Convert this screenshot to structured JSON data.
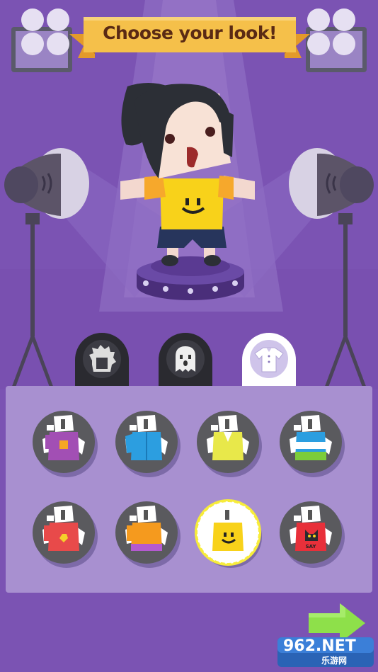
{
  "header": {
    "title": "Choose your look!"
  },
  "tabs": [
    {
      "name": "hair",
      "icon": "hair-icon",
      "selected": false
    },
    {
      "name": "face",
      "icon": "ghost-face-icon",
      "selected": false
    },
    {
      "name": "shirt",
      "icon": "shirt-icon",
      "selected": true
    }
  ],
  "outfits": [
    {
      "icon": "purple-shirt-icon",
      "color": "#a24fb4",
      "selected": false
    },
    {
      "icon": "blue-jacket-icon",
      "color": "#2c9ee0",
      "selected": false
    },
    {
      "icon": "yellow-vest-icon",
      "color": "#e8e84a",
      "selected": false
    },
    {
      "icon": "blue-striped-shirt-icon",
      "color": "#2c9ee0",
      "selected": false
    },
    {
      "icon": "red-flower-shirt-icon",
      "color": "#e84a4a",
      "selected": false
    },
    {
      "icon": "orange-shirt-icon",
      "color": "#f59a1e",
      "selected": false
    },
    {
      "icon": "yellow-smiley-shirt-icon",
      "color": "#f8d21a",
      "selected": true
    },
    {
      "icon": "red-cat-shirt-icon",
      "color": "#e8303a",
      "selected": false
    }
  ],
  "cat_shirt_text": "SAY",
  "watermark": {
    "brand": "962.NET",
    "subtitle": "乐游网"
  },
  "colors": {
    "background": "#7b53b3",
    "panel": "#a890d0",
    "banner": "#f5c04a",
    "next_arrow": "#8ee04a"
  }
}
